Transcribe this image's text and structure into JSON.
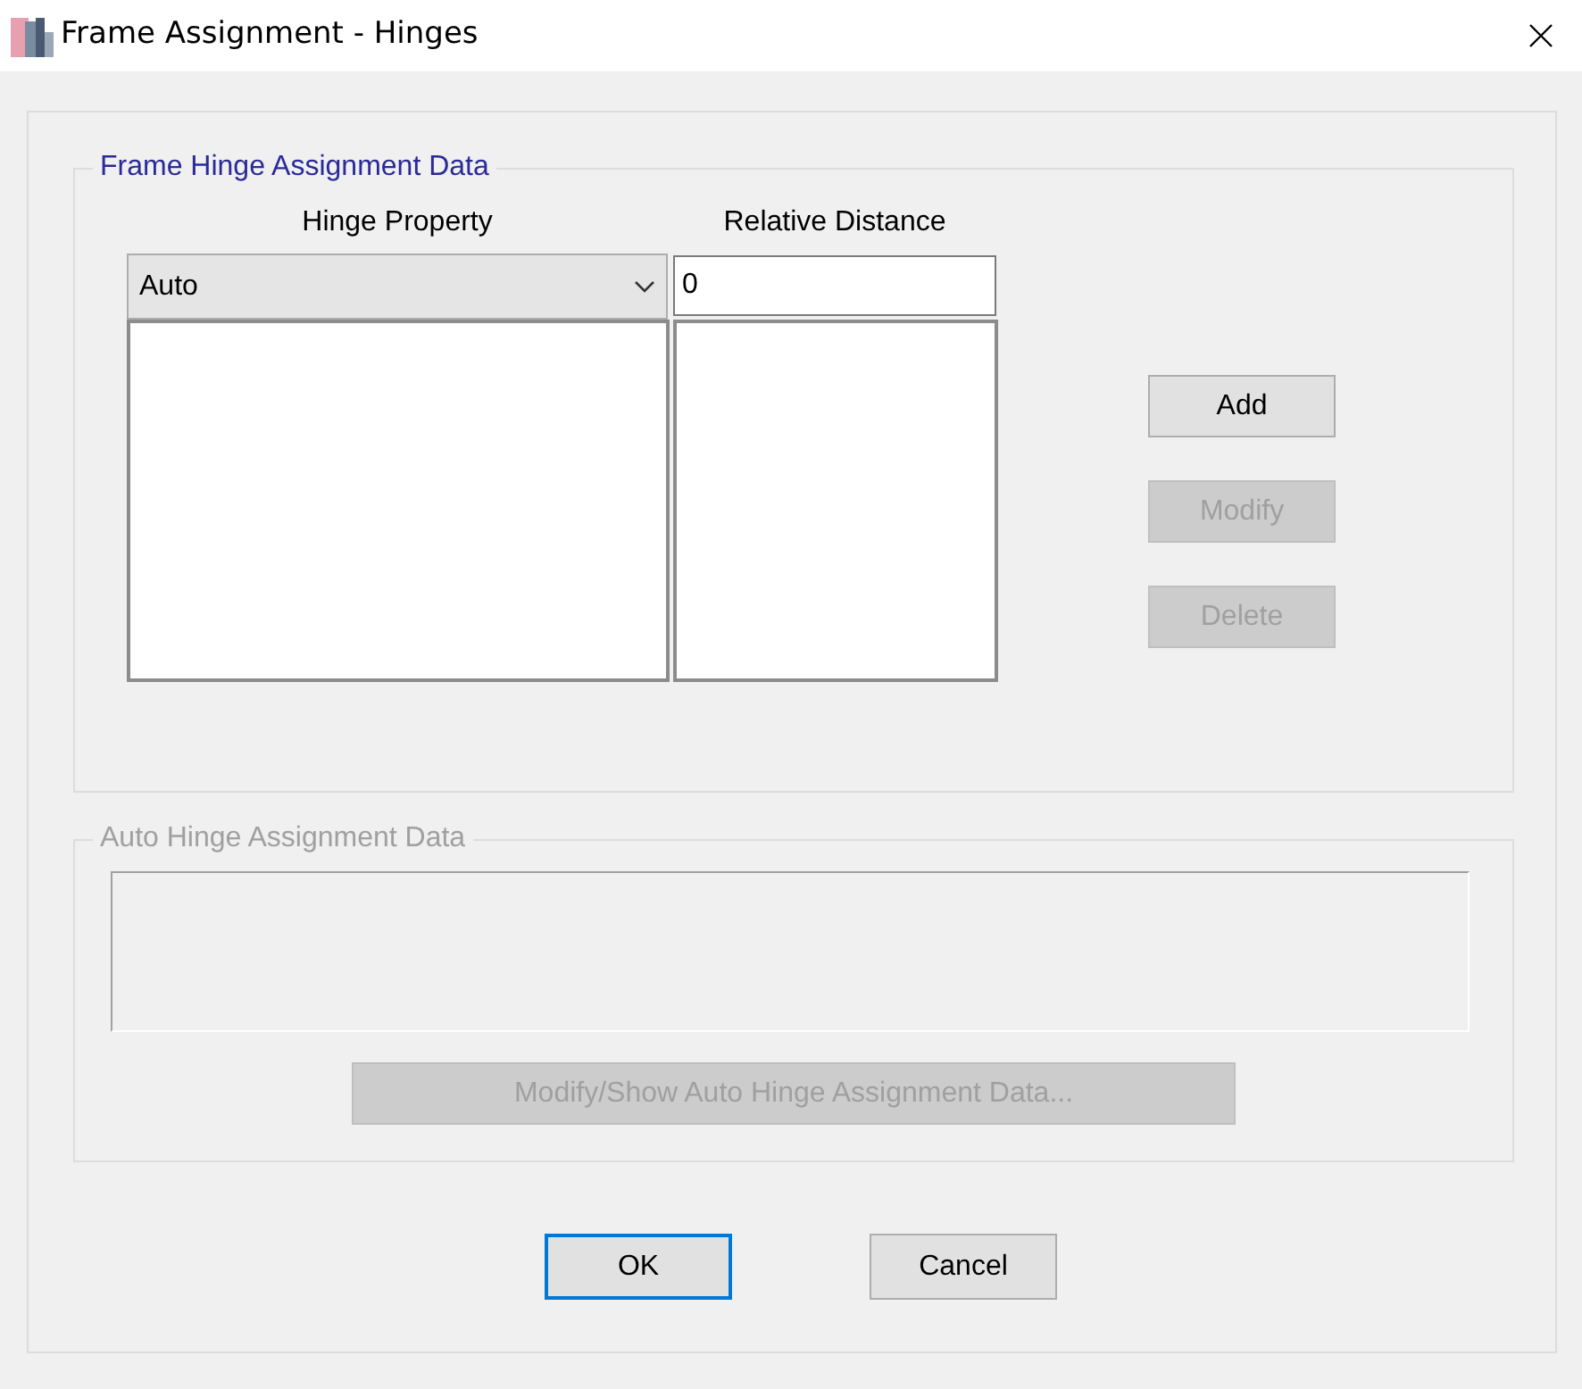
{
  "window": {
    "title": "Frame Assignment - Hinges"
  },
  "frame_hinge_group": {
    "title": "Frame Hinge Assignment Data",
    "columns": [
      "Hinge Property",
      "Relative Distance"
    ],
    "hinge_property": {
      "value": "Auto"
    },
    "relative_distance": {
      "value": "0"
    },
    "buttons": [
      {
        "label": "Add",
        "disabled": false
      },
      {
        "label": "Modify",
        "disabled": true
      },
      {
        "label": "Delete",
        "disabled": true
      }
    ]
  },
  "auto_hinge_group": {
    "title": "Auto Hinge Assignment Data",
    "disabled": true,
    "button": {
      "label": "Modify/Show Auto Hinge Assignment Data...",
      "disabled": true
    }
  },
  "footer_buttons": [
    {
      "label": "OK",
      "focused": true
    },
    {
      "label": "Cancel",
      "focused": false
    }
  ]
}
